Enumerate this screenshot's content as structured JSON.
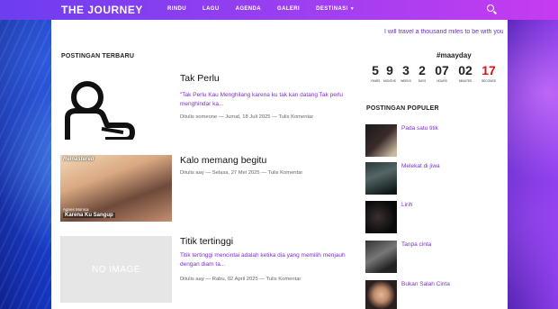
{
  "site": {
    "title": "THE JOURNEY"
  },
  "nav": {
    "items": [
      "RINDU",
      "LAGU",
      "AGENDA",
      "GALERI",
      "DESTINASI"
    ]
  },
  "icons": {
    "search": "search-icon",
    "dropdown": "caret-down-icon"
  },
  "colors": {
    "accent": "#7b2fd0",
    "nav_start": "#6d3df0",
    "nav_end": "#c63bf0",
    "countdown_seconds": "#dd1111"
  },
  "ticker": {
    "text": "I will travel a thousand miles to be with you"
  },
  "recent": {
    "heading": "POSTINGAN TERBARU",
    "posts": [
      {
        "title": "Tak Perlu",
        "excerpt": "\"Tak Perlu Kau Menghilang karena ku tak kan datang Tak perlu menghindar ka...",
        "meta": "Ditulis someone — Jumat, 18 Juli 2025 — Tulis Komentar"
      },
      {
        "title": "Kalo memang begitu",
        "excerpt": "",
        "meta": "Ditulis aay — Selasa, 27 Mei 2025 — Tulis Komentar",
        "thumb_brand": "Remastered",
        "thumb_artist": "Agnes Monica",
        "thumb_album": "Karena Ku Sangup"
      },
      {
        "title": "Titik tertinggi",
        "excerpt": "Titik tertinggi mencintai adalah ketika dia yang memilih menjauh dengan diam ta...",
        "meta": "Ditulis aay — Rabu, 02 April 2025 — Tulis Komentar",
        "thumb_text": "NO IMAGE"
      }
    ]
  },
  "countdown": {
    "title": "#maayday",
    "cells": [
      {
        "value": "5",
        "label": "YEARS"
      },
      {
        "value": "9",
        "label": "MONTHS"
      },
      {
        "value": "3",
        "label": "WEEKS"
      },
      {
        "value": "2",
        "label": "DAYS"
      },
      {
        "value": "07",
        "label": "HOURS"
      },
      {
        "value": "02",
        "label": "MINUTES"
      },
      {
        "value": "17",
        "label": "SECONDS"
      }
    ]
  },
  "popular": {
    "heading": "POSTINGAN POPULER",
    "items": [
      "Pada satu titik",
      "Melekat di jiwa",
      "Lirih",
      "Tanpa cinta",
      "Bukan Salah Cinta"
    ]
  }
}
